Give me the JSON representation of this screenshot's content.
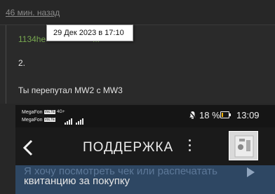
{
  "forum": {
    "time_ago": "46 мин. назад",
    "quote_author": "1134he",
    "quote_rest": "...",
    "tooltip": "29 Дек 2023 в 17:10",
    "reply_line1": "2.",
    "reply_line2": "Ты перепутал MW2 с MW3"
  },
  "phone": {
    "carrier1": "MegaFon",
    "carrier2": "MegaFon",
    "volte_tag": "VoLTE",
    "network": "4G+",
    "battery_text": "18 %",
    "battery_level": 0.18,
    "clock": "13:09",
    "header_title": "ПОДДЕРЖКА",
    "message_line1": "Я хочу посмотреть чек или распечатать",
    "message_line2": "квитанцию за покупку",
    "icons": [
      "back-arrow-icon",
      "kebab-menu-icon",
      "bell-muted-icon",
      "battery-icon",
      "signal-icon",
      "play-icon"
    ],
    "colors": {
      "bubble": "#2e4763",
      "battery_fill": "#f0b000",
      "quote": "#78a850"
    }
  }
}
